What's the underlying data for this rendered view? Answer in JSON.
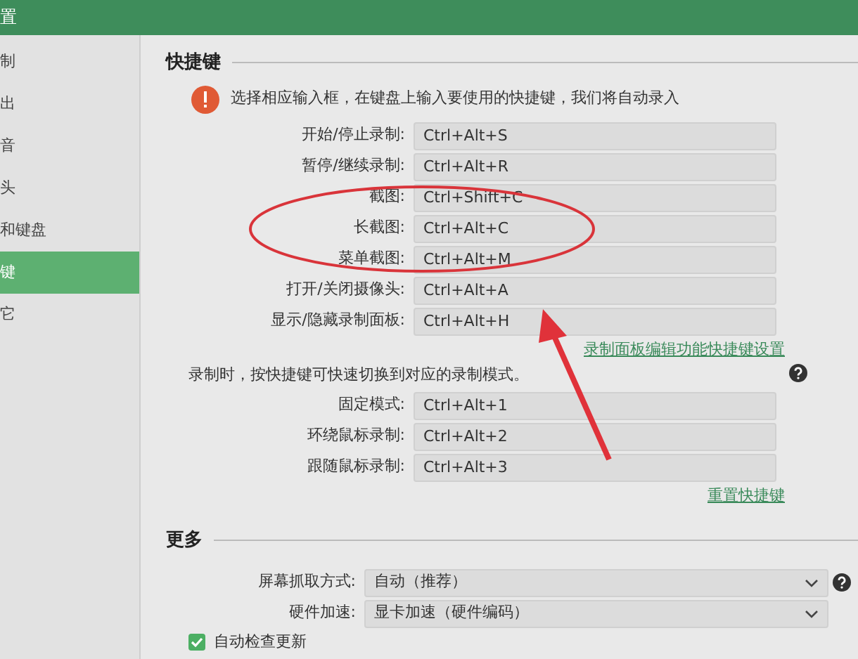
{
  "window": {
    "title": "置"
  },
  "sidebar": {
    "items": [
      {
        "label": "制",
        "selected": false
      },
      {
        "label": "出",
        "selected": false
      },
      {
        "label": "音",
        "selected": false
      },
      {
        "label": "头",
        "selected": false
      },
      {
        "label": "和键盘",
        "selected": false
      },
      {
        "label": "键",
        "selected": true
      },
      {
        "label": "它",
        "selected": false
      }
    ]
  },
  "shortcuts": {
    "title": "快捷键",
    "notice": "选择相应输入框，在键盘上输入要使用的快捷键，我们将自动录入",
    "rows": [
      {
        "label": "开始/停止录制:",
        "value": "Ctrl+Alt+S"
      },
      {
        "label": "暂停/继续录制:",
        "value": "Ctrl+Alt+R"
      },
      {
        "label": "截图:",
        "value": "Ctrl+Shift+C"
      },
      {
        "label": "长截图:",
        "value": "Ctrl+Alt+C"
      },
      {
        "label": "菜单截图:",
        "value": "Ctrl+Alt+M"
      },
      {
        "label": "打开/关闭摄像头:",
        "value": "Ctrl+Alt+A"
      },
      {
        "label": "显示/隐藏录制面板:",
        "value": "Ctrl+Alt+H"
      }
    ],
    "panel_link": "录制面板编辑功能快捷键设置",
    "mode_note": "录制时，按快捷键可快速切换到对应的录制模式。",
    "mode_rows": [
      {
        "label": "固定模式:",
        "value": "Ctrl+Alt+1"
      },
      {
        "label": "环绕鼠标录制:",
        "value": "Ctrl+Alt+2"
      },
      {
        "label": "跟随鼠标录制:",
        "value": "Ctrl+Alt+3"
      }
    ],
    "reset_link": "重置快捷键"
  },
  "more": {
    "title": "更多",
    "selects": [
      {
        "label": "屏幕抓取方式:",
        "value": "自动（推荐）",
        "help": true
      },
      {
        "label": "硬件加速:",
        "value": "显卡加速（硬件编码）",
        "help": false
      }
    ],
    "checkbox": {
      "label": "自动检查更新",
      "checked": true
    }
  }
}
